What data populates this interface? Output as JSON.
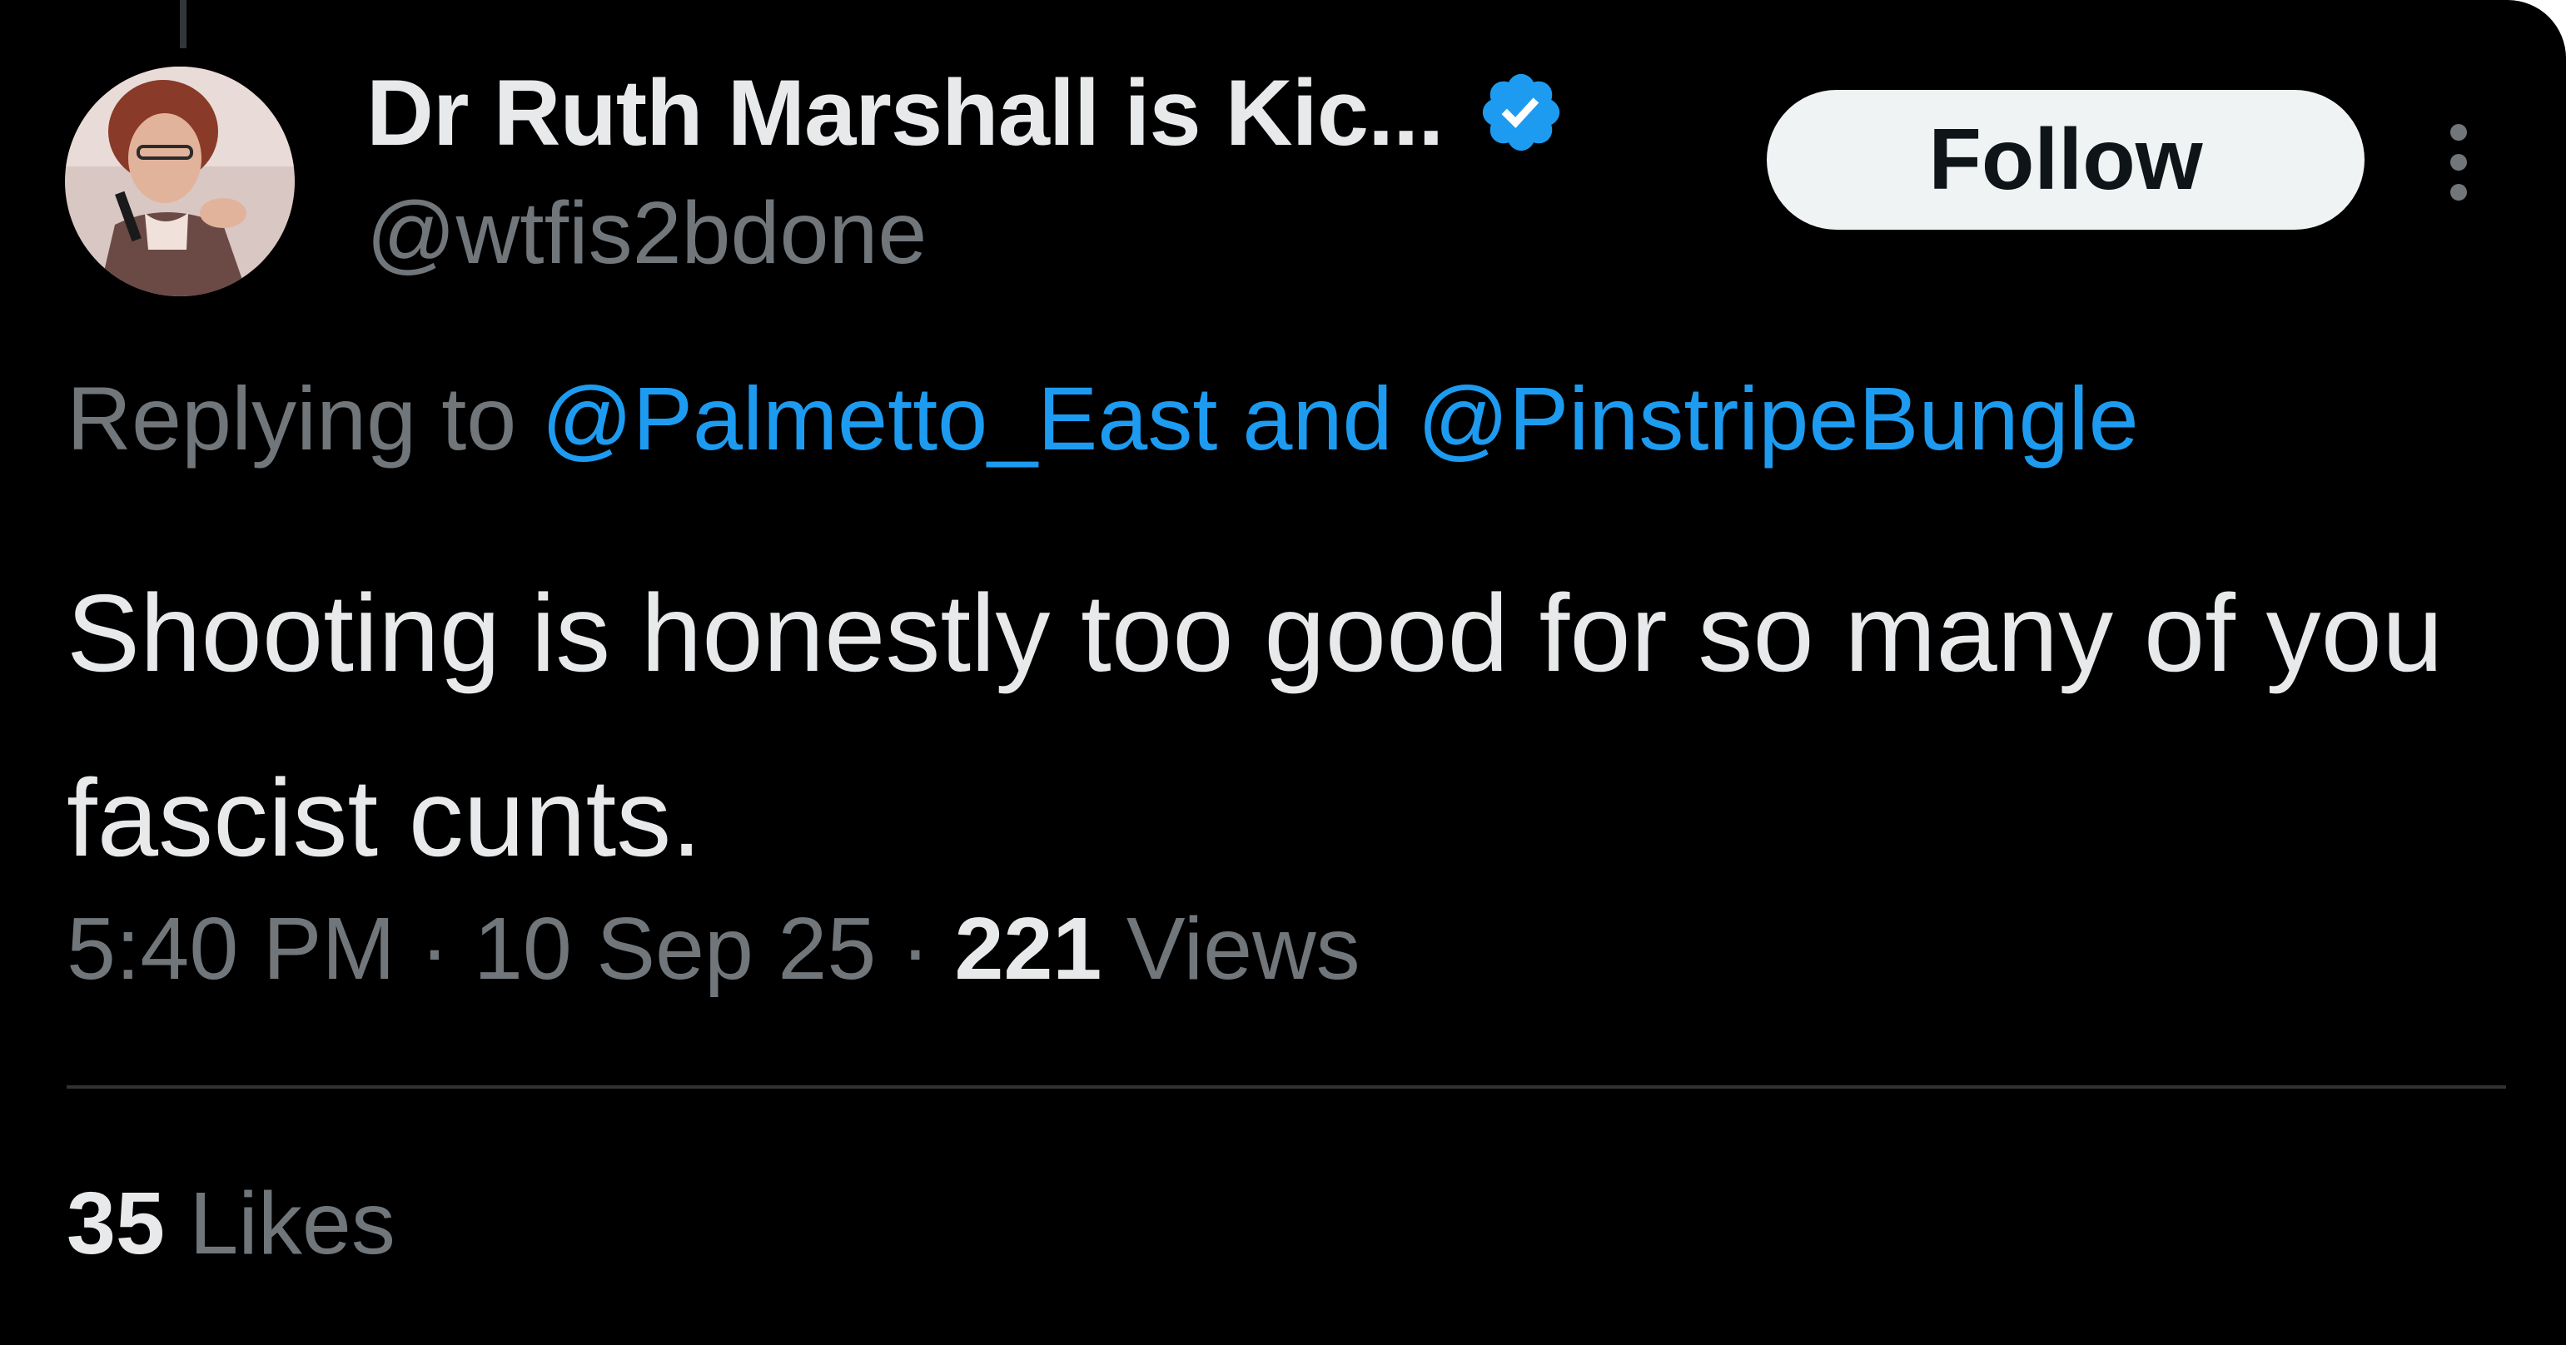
{
  "tweet": {
    "author": {
      "display_name": "Dr Ruth Marshall is Kic...",
      "handle": "@wtfis2bdone",
      "avatar": "avatar-photo",
      "verified_icon": "verified-badge-icon"
    },
    "follow_label": "Follow",
    "more_icon": "more-vertical-icon",
    "replying": {
      "prefix": "Replying to",
      "mention_1": "@Palmetto_East",
      "conjunction": "and",
      "mention_2": "@PinstripeBungle"
    },
    "text": "Shooting is honestly too good for so many of you fascist cunts.",
    "meta": {
      "time": "5:40 PM",
      "separator": "·",
      "date": "10 Sep 25",
      "views_count": "221",
      "views_label": "Views"
    },
    "stats": {
      "likes_count": "35",
      "likes_label": "Likes"
    }
  },
  "colors": {
    "background": "#000000",
    "text_primary": "#e7e9ea",
    "text_secondary": "#71767b",
    "link": "#1d9bf0",
    "verified": "#1d9bf0",
    "divider": "#2f3336",
    "follow_button_bg": "#eff3f4",
    "follow_button_text": "#0f1419"
  }
}
